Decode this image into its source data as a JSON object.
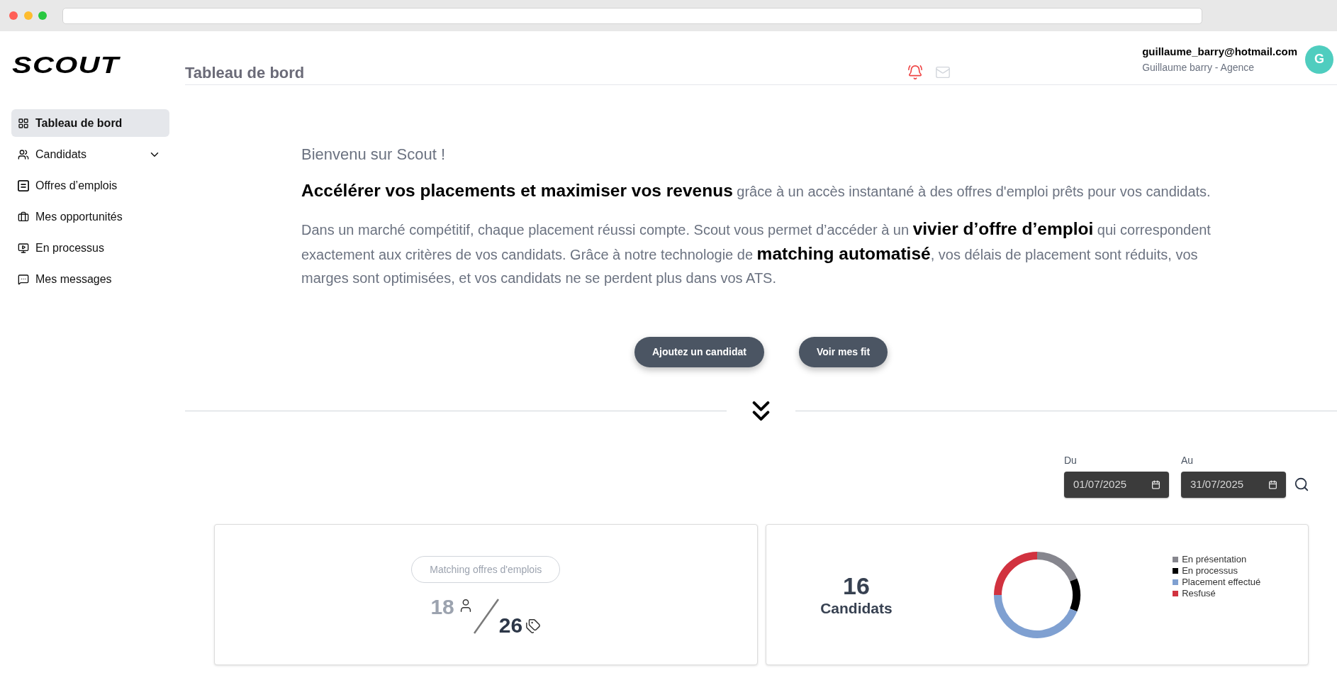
{
  "logo": "SCOUT",
  "sidebar": {
    "items": [
      {
        "label": "Tableau de bord",
        "kind": "link",
        "selected": true
      },
      {
        "label": "Candidats",
        "kind": "group",
        "selected": false,
        "expanded": false
      },
      {
        "label": "Offres d’emplois",
        "kind": "link",
        "selected": false
      },
      {
        "label": "Mes opportunités",
        "kind": "link",
        "selected": false
      },
      {
        "label": "En processus",
        "kind": "link",
        "selected": false
      },
      {
        "label": "Mes messages",
        "kind": "link",
        "selected": false
      }
    ]
  },
  "header": {
    "title": "Tableau de bord",
    "notifications": {
      "active": true
    },
    "messages": {
      "active": false
    },
    "user": {
      "email": "guillaume_barry@hotmail.com",
      "subtitle": "Guillaume barry - Agence",
      "initial": "G"
    }
  },
  "welcome": {
    "greeting": "Bienvenu sur Scout !",
    "headline": "**Accélérer vos placements et maximiser vos revenus** grâce à un accès instantané à des offres d'emploi prêts pour vos candidats.",
    "body": "Dans un marché compétitif, chaque placement réussi compte. Scout vous permet d’accéder à un **vivier d’offre d’emploi** qui correspondent exactement aux critères de vos candidats. Grâce à notre technologie de **matching automatisé**, vos délais de placement sont réduits, vos marges sont optimisées, et vos candidats ne se perdent plus dans vos ATS.",
    "actions": [
      "Ajoutez un candidat",
      "Voir mes fit"
    ]
  },
  "filters": [
    {
      "label": "Du",
      "value": "01/07/2025"
    },
    {
      "label": "Au",
      "value": "31/07/2025"
    }
  ],
  "matching_card": {
    "label": "Matching offres d'emplois",
    "candidates": "18",
    "offers": "26"
  },
  "candidates_card": {
    "count": "16",
    "label": "Candidats",
    "legend": [
      {
        "label": "En présentation",
        "color": "#86868e"
      },
      {
        "label": "En processus",
        "color": "#000000"
      },
      {
        "label": "Placement effectué",
        "color": "#7fa0d1"
      },
      {
        "label": "Resfusé",
        "color": "#d1323f"
      }
    ]
  }
}
